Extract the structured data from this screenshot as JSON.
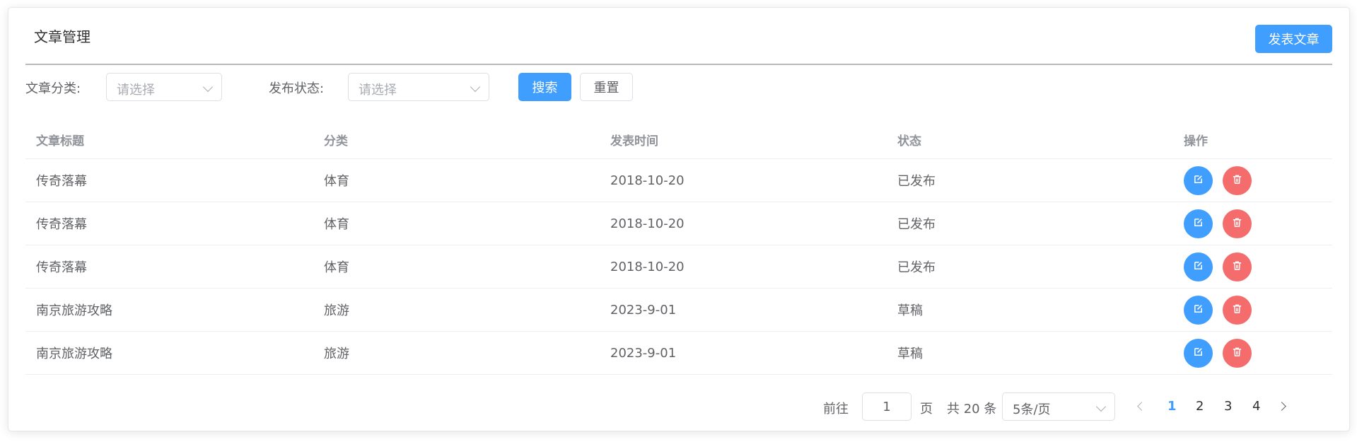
{
  "header": {
    "title": "文章管理",
    "publish_label": "发表文章"
  },
  "filters": {
    "category_label": "文章分类:",
    "category_placeholder": "请选择",
    "status_label": "发布状态:",
    "status_placeholder": "请选择",
    "search_label": "搜索",
    "reset_label": "重置"
  },
  "table": {
    "columns": [
      "文章标题",
      "分类",
      "发表时间",
      "状态",
      "操作"
    ],
    "rows": [
      {
        "title": "传奇落幕",
        "category": "体育",
        "date": "2018-10-20",
        "status": "已发布"
      },
      {
        "title": "传奇落幕",
        "category": "体育",
        "date": "2018-10-20",
        "status": "已发布"
      },
      {
        "title": "传奇落幕",
        "category": "体育",
        "date": "2018-10-20",
        "status": "已发布"
      },
      {
        "title": "南京旅游攻略",
        "category": "旅游",
        "date": "2023-9-01",
        "status": "草稿"
      },
      {
        "title": "南京旅游攻略",
        "category": "旅游",
        "date": "2023-9-01",
        "status": "草稿"
      }
    ]
  },
  "pagination": {
    "goto_label": "前往",
    "goto_value": "1",
    "page_unit": "页",
    "total_text": "共 20 条",
    "page_size": "5条/页",
    "pages": [
      "1",
      "2",
      "3",
      "4"
    ],
    "current_page": "1"
  },
  "colors": {
    "primary": "#409eff",
    "danger": "#f56c6c"
  },
  "icons": {
    "edit": "edit-icon",
    "delete": "delete-icon"
  }
}
